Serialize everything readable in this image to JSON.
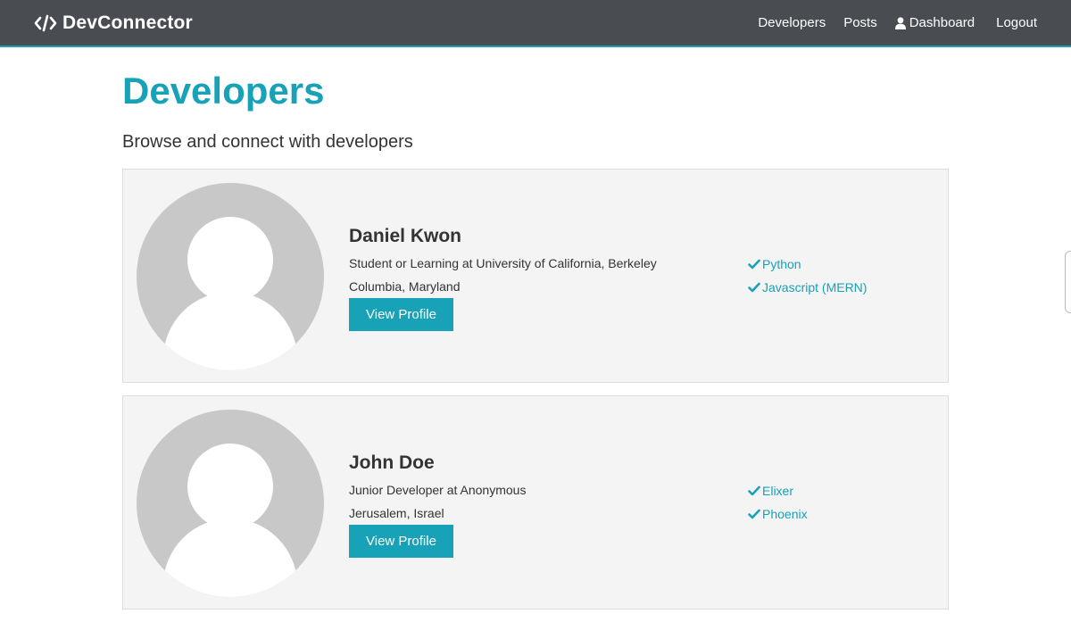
{
  "navbar": {
    "brand": "DevConnector",
    "links": {
      "developers": "Developers",
      "posts": "Posts",
      "dashboard": "Dashboard",
      "logout": "Logout"
    }
  },
  "page": {
    "title": "Developers",
    "subtitle": "Browse and connect with developers"
  },
  "profiles": [
    {
      "name": "Daniel Kwon",
      "status": "Student or Learning at University of California, Berkeley",
      "location": "Columbia, Maryland",
      "button": "View Profile",
      "skills": [
        "Python",
        "Javascript (MERN)"
      ]
    },
    {
      "name": "John Doe",
      "status": "Junior Developer at Anonymous",
      "location": "Jerusalem, Israel",
      "button": "View Profile",
      "skills": [
        "Elixer",
        "Phoenix"
      ]
    }
  ],
  "colors": {
    "navbar_bg": "#494d52",
    "accent": "#17a2b8",
    "card_bg": "#f4f4f4",
    "avatar_bg": "#c8c8c8"
  },
  "icons": {
    "brand": "code-icon",
    "dashboard": "user-icon",
    "skill": "check-icon"
  }
}
